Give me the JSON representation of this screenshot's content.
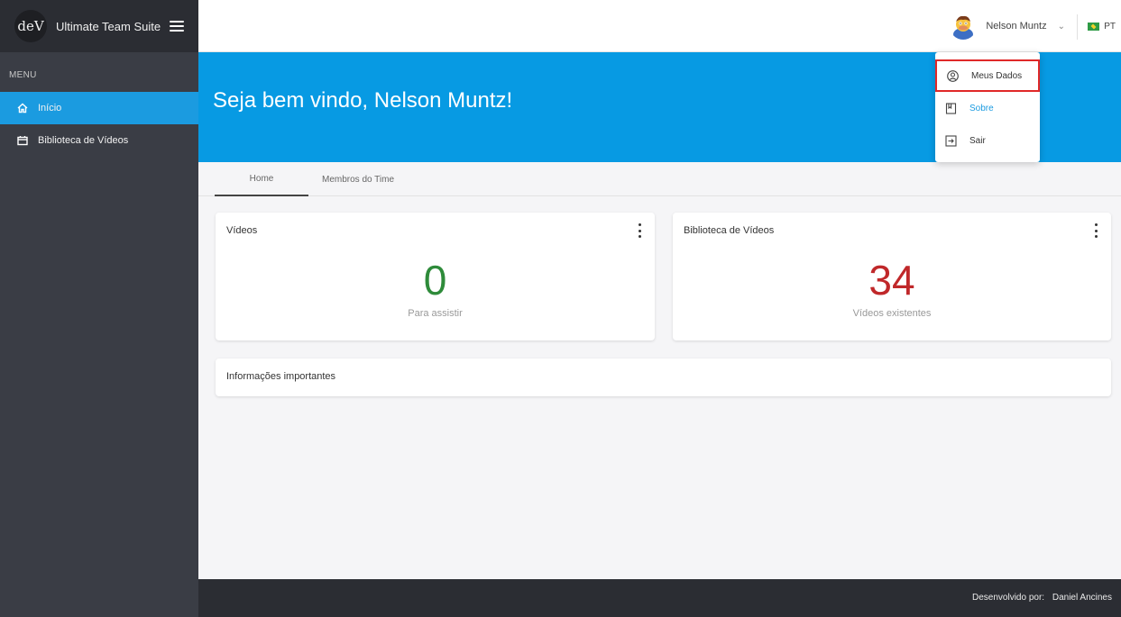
{
  "brand": {
    "logo_text": "deV",
    "title": "Ultimate Team Suite"
  },
  "sidebar": {
    "heading": "MENU",
    "items": [
      {
        "label": "Início",
        "icon": "home-icon",
        "active": true
      },
      {
        "label": "Biblioteca de Vídeos",
        "icon": "video-library-icon",
        "active": false
      }
    ]
  },
  "topbar": {
    "user_name": "Nelson Muntz",
    "language": "PT"
  },
  "banner": {
    "welcome": "Seja bem vindo, Nelson Muntz!"
  },
  "tabs": [
    {
      "label": "Home",
      "active": true
    },
    {
      "label": "Membros do Time",
      "active": false
    }
  ],
  "cards": {
    "videos": {
      "title": "Vídeos",
      "value": "0",
      "caption": "Para assistir",
      "color": "#2e8b3a"
    },
    "library": {
      "title": "Biblioteca de Vídeos",
      "value": "34",
      "caption": "Vídeos existentes",
      "color": "#c0282a"
    },
    "info": {
      "title": "Informações importantes"
    }
  },
  "dropdown": {
    "items": [
      {
        "label": "Meus Dados",
        "icon": "user-circle-icon"
      },
      {
        "label": "Sobre",
        "icon": "book-icon"
      },
      {
        "label": "Sair",
        "icon": "logout-icon"
      }
    ]
  },
  "footer": {
    "prefix": "Desenvolvido por:",
    "author": "Daniel Ancines"
  },
  "colors": {
    "accent": "#079ae3",
    "sidebar": "#3a3d45",
    "dark": "#2b2d33",
    "highlight": "#e02828"
  }
}
